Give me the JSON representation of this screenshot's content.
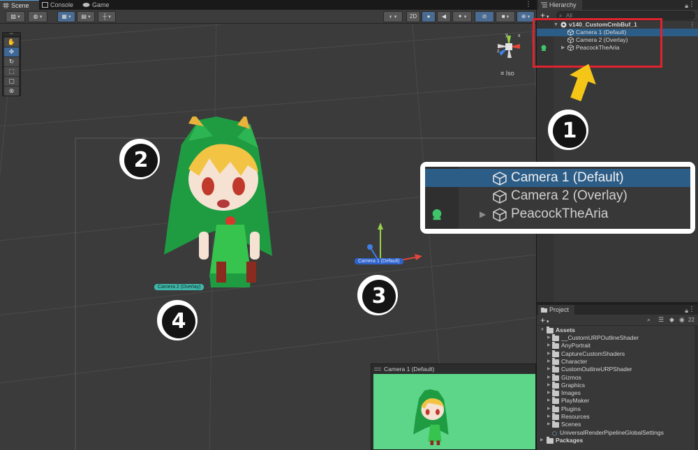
{
  "scene_tabs": [
    {
      "label": "Scene"
    },
    {
      "label": "Console"
    },
    {
      "label": "Game"
    }
  ],
  "scene_toolbar": {
    "mode_2d": "2D",
    "iso_label": "Iso"
  },
  "scene": {
    "camera1_label": "Camera 1 (Default)",
    "camera2_label": "Camera 2 (Overlay)",
    "preview_title": "Camera 1 (Default)",
    "preview_bg": "#5dd68a",
    "character_color": "#1f9b42"
  },
  "badges": [
    "1",
    "2",
    "3",
    "4"
  ],
  "hierarchy": {
    "tab": "Hierarchy",
    "search_placeholder": "All",
    "scene_name": "v140_CustomCmbBuf_1",
    "items": [
      {
        "label": "Camera 1 (Default)",
        "selected": true
      },
      {
        "label": "Camera 2 (Overlay)",
        "selected": false
      },
      {
        "label": "PeacockTheAria",
        "selected": false,
        "has_children": true
      }
    ]
  },
  "callout": {
    "items": [
      "Camera 1 (Default)",
      "Camera 2 (Overlay)",
      "PeacockTheAria"
    ]
  },
  "project": {
    "tab": "Project",
    "count": "22",
    "root": "Assets",
    "folders": [
      "__CustomURPOutlineShader",
      "AnyPortrait",
      "CaptureCustomShaders",
      "Character",
      "CustomOutlineURPShader",
      "Gizmos",
      "Graphics",
      "Images",
      "PlayMaker",
      "Plugins",
      "Resources",
      "Scenes"
    ],
    "asset_file": "UniversalRenderPipelineGlobalSettings",
    "packages": "Packages"
  },
  "colors": {
    "highlight_red": "#e0242f",
    "arrow_yellow": "#f5c518",
    "selection_blue": "#2c5d87"
  }
}
